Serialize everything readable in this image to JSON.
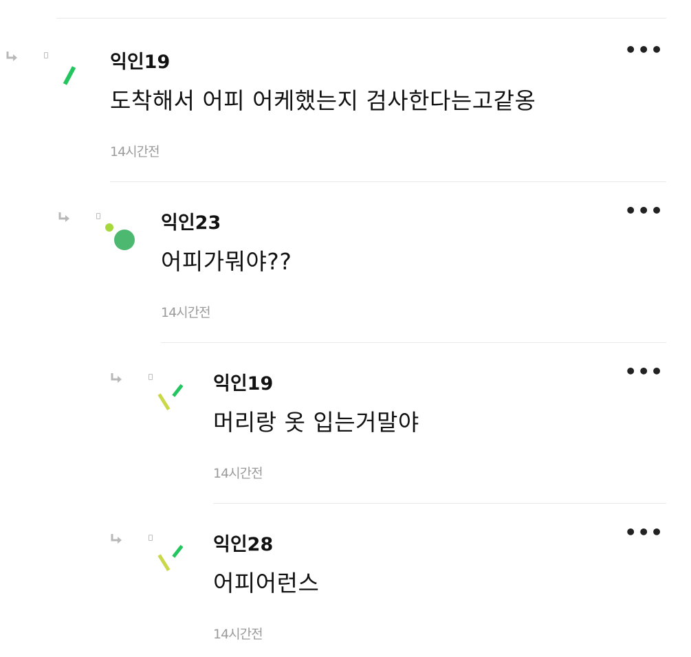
{
  "comments": [
    {
      "author": "익인19",
      "body": "도착해서 어피 어케했는지 검사한다는고같옹",
      "time": "14시간전",
      "more": "•••"
    },
    {
      "author": "익인23",
      "body": "어피가뭐야??",
      "time": "14시간전",
      "more": "•••"
    },
    {
      "author": "익인19",
      "body": "머리랑 옷 입는거말야",
      "time": "14시간전",
      "more": "•••"
    },
    {
      "author": "익인28",
      "body": "어피어런스",
      "time": "14시간전",
      "more": "•••"
    }
  ],
  "colors": {
    "accent_green": "#22c55e",
    "avatar_green": "#4cb870",
    "lime": "#a5d83a",
    "yellow_green": "#c9d84a",
    "time_gray": "#9a9a9a",
    "divider": "#e8e8e8"
  }
}
